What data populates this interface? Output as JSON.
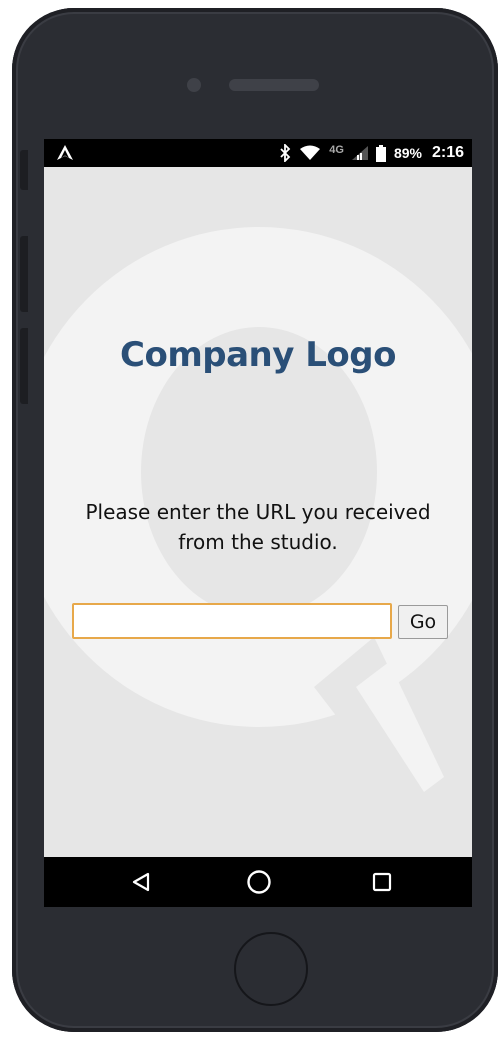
{
  "status_bar": {
    "left_icon": "app-notification-icon",
    "icons": [
      "bluetooth-icon",
      "wifi-icon",
      "lte-icon",
      "cell-signal-icon",
      "battery-icon"
    ],
    "network_label": "4G",
    "battery": "89%",
    "time": "2:16"
  },
  "main": {
    "logo_text": "Company Logo",
    "prompt_line1": "Please enter the URL you received",
    "prompt_line2": "from the studio.",
    "url_input": {
      "value": "",
      "placeholder": ""
    },
    "go_label": "Go"
  },
  "nav_bar": {
    "back_icon": "back-triangle-icon",
    "home_icon": "home-circle-icon",
    "recent_icon": "recent-apps-square-icon"
  },
  "colors": {
    "logo": "#2a4f77",
    "background": "#e6e6e6",
    "input_border": "#e7a84a",
    "phone_body": "#2b2d33"
  }
}
